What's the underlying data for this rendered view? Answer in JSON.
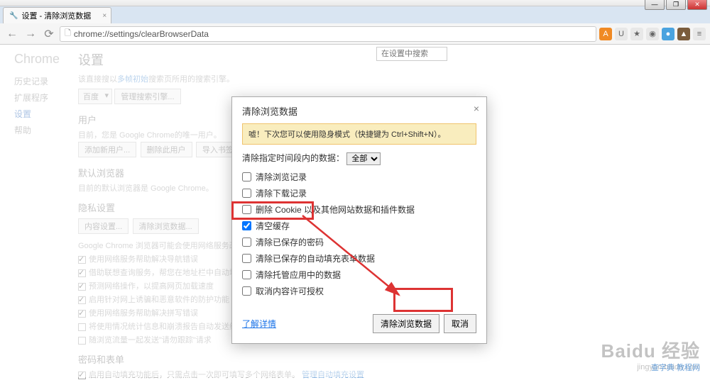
{
  "window": {
    "title": "设置 - 清除浏览数据"
  },
  "omnibox": {
    "url": "chrome://settings/clearBrowserData"
  },
  "extensions": [
    {
      "name": "ext-a",
      "bg": "#f08a24",
      "glyph": "A"
    },
    {
      "name": "ext-u",
      "bg": "#e8e8e8",
      "glyph": "U"
    },
    {
      "name": "ext-star",
      "bg": "#e8e8e8",
      "glyph": "★"
    },
    {
      "name": "ext-shield",
      "bg": "#e8e8e8",
      "glyph": "◉"
    },
    {
      "name": "ext-circle",
      "bg": "#4aa3df",
      "glyph": "●"
    },
    {
      "name": "ext-mtn",
      "bg": "#7a5c3c",
      "glyph": "▲"
    },
    {
      "name": "ext-wrench",
      "bg": "#e8e8e8",
      "glyph": "≡"
    }
  ],
  "sidebar": {
    "brand": "Chrome",
    "items": [
      "历史记录",
      "扩展程序",
      "设置",
      "帮助"
    ],
    "active_index": 2
  },
  "settings": {
    "page_title": "设置",
    "note_prefix": "该直接搜以",
    "note_link": "多帧初始",
    "note_suffix": "搜索页所用的搜索引擎。",
    "engine_selected": "百度",
    "manage_engines": "管理搜索引擎...",
    "search_placeholder": "在设置中搜索",
    "user_heading": "用户",
    "user_note": "目前，您是 Google Chrome的唯一用户。",
    "add_user": "添加新用户...",
    "delete_user": "删除此用户",
    "import_bookmarks": "导入书签和设置...",
    "default_browser_heading": "默认浏览器",
    "default_browser_note": "目前的默认浏览器是 Google Chrome。",
    "privacy_heading": "隐私设置",
    "content_settings": "内容设置...",
    "clear_browsing_btn": "清除浏览数据...",
    "privacy_note": "Google Chrome 浏览器可能会使用网络服务改善您的浏览体验。",
    "priv_opts": [
      "使用网络服务帮助解决导航错误",
      "借助联想查询服务，帮您在地址栏中自动填充未输完的搜索字词和网址",
      "预测网络操作，以提高网页加载速度",
      "启用针对网上诱骗和恶意软件的防护功能",
      "使用网络服务帮助解决拼写错误",
      "将使用情况统计信息和崩溃报告自动发送给 Google",
      "随浏览流量一起发送\"请勿跟踪\"请求"
    ],
    "passwords_heading": "密码和表单",
    "pw_opt": "启用自动填充功能后，只需点击一次即可填写多个网络表单。",
    "pw_link": "管理自动填充设置"
  },
  "dialog": {
    "title": "清除浏览数据",
    "tip": "嘘！下次您可以使用隐身模式（快捷键为 Ctrl+Shift+N）。",
    "range_label": "清除指定时间段内的数据：",
    "range_value": "全部",
    "options": [
      {
        "label": "清除浏览记录",
        "checked": false
      },
      {
        "label": "清除下载记录",
        "checked": false
      },
      {
        "label": "删除 Cookie 以及其他网站数据和插件数据",
        "checked": false
      },
      {
        "label": "清空缓存",
        "checked": true
      },
      {
        "label": "清除已保存的密码",
        "checked": false
      },
      {
        "label": "清除已保存的自动填充表单数据",
        "checked": false
      },
      {
        "label": "清除托管应用中的数据",
        "checked": false
      },
      {
        "label": "取消内容许可授权",
        "checked": false
      }
    ],
    "learn_more": "了解详情",
    "confirm": "清除浏览数据",
    "cancel": "取消"
  },
  "watermark": {
    "brand": "Baidu 经验",
    "url": "jingyan.baidu.com",
    "site": "查字典 教程网"
  }
}
